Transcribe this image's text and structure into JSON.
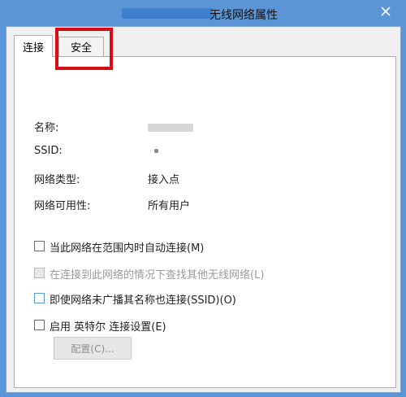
{
  "window": {
    "title": "无线网络属性"
  },
  "tabs": [
    {
      "label": "连接",
      "active": true
    },
    {
      "label": "安全",
      "active": false
    }
  ],
  "properties": [
    {
      "label": "名称:",
      "value": ""
    },
    {
      "label": "SSID:",
      "value": ""
    },
    {
      "label": "网络类型:",
      "value": "接入点"
    },
    {
      "label": "网络可用性:",
      "value": "所有用户"
    }
  ],
  "options": [
    {
      "label": "当此网络在范围内时自动连接(M)",
      "checked": false,
      "enabled": true
    },
    {
      "label": "在连接到此网络的情况下查找其他无线网络(L)",
      "checked": false,
      "enabled": false
    },
    {
      "label": "即使网络未广播其名称也连接(SSID)(O)",
      "checked": false,
      "enabled": true
    },
    {
      "label": "启用 英特尔 连接设置(E)",
      "checked": false,
      "enabled": true
    }
  ],
  "configure_button": {
    "label": "配置(C)..."
  },
  "colors": {
    "highlight_box": "#d80c17",
    "title_bar": "#5b95d6"
  }
}
